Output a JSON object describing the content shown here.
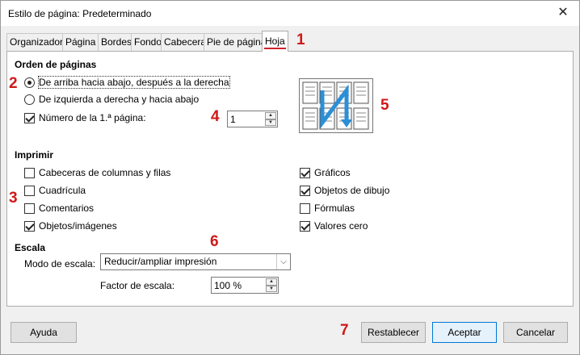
{
  "window": {
    "title": "Estilo de página: Predeterminado",
    "close_symbol": "✕"
  },
  "tabs": [
    {
      "label": "Organizador"
    },
    {
      "label": "Página"
    },
    {
      "label": "Bordes"
    },
    {
      "label": "Fondo"
    },
    {
      "label": "Cabecera"
    },
    {
      "label": "Pie de página"
    },
    {
      "label": "Hoja",
      "active": true
    }
  ],
  "page_order": {
    "title": "Orden de páginas",
    "option_top_down": "De arriba hacia abajo, después a la derecha",
    "option_left_right": "De izquierda a derecha y hacia abajo",
    "selected": "top_down",
    "first_page_label": "Número de la 1.ª página:",
    "first_page_checked": true,
    "first_page_value": "1",
    "preview_icon": "page-order-preview-icon"
  },
  "print": {
    "title": "Imprimir",
    "left": [
      {
        "label": "Cabeceras de columnas y filas",
        "checked": false
      },
      {
        "label": "Cuadrícula",
        "checked": false
      },
      {
        "label": "Comentarios",
        "checked": false
      },
      {
        "label": "Objetos/imágenes",
        "checked": true
      }
    ],
    "right": [
      {
        "label": "Gráficos",
        "checked": true
      },
      {
        "label": "Objetos de dibujo",
        "checked": true
      },
      {
        "label": "Fórmulas",
        "checked": false
      },
      {
        "label": "Valores cero",
        "checked": true
      }
    ]
  },
  "scale": {
    "title": "Escala",
    "mode_label": "Modo de escala:",
    "mode_value": "Reducir/ampliar impresión",
    "factor_label": "Factor de escala:",
    "factor_value": "100 %"
  },
  "markers": [
    "1",
    "2",
    "3",
    "4",
    "5",
    "6",
    "7"
  ],
  "buttons": {
    "help": "Ayuda",
    "reset": "Restablecer",
    "ok": "Aceptar",
    "cancel": "Cancelar"
  },
  "colors": {
    "marker": "#d01818",
    "accent": "#0078d7",
    "arrow": "#2b8fd6"
  }
}
